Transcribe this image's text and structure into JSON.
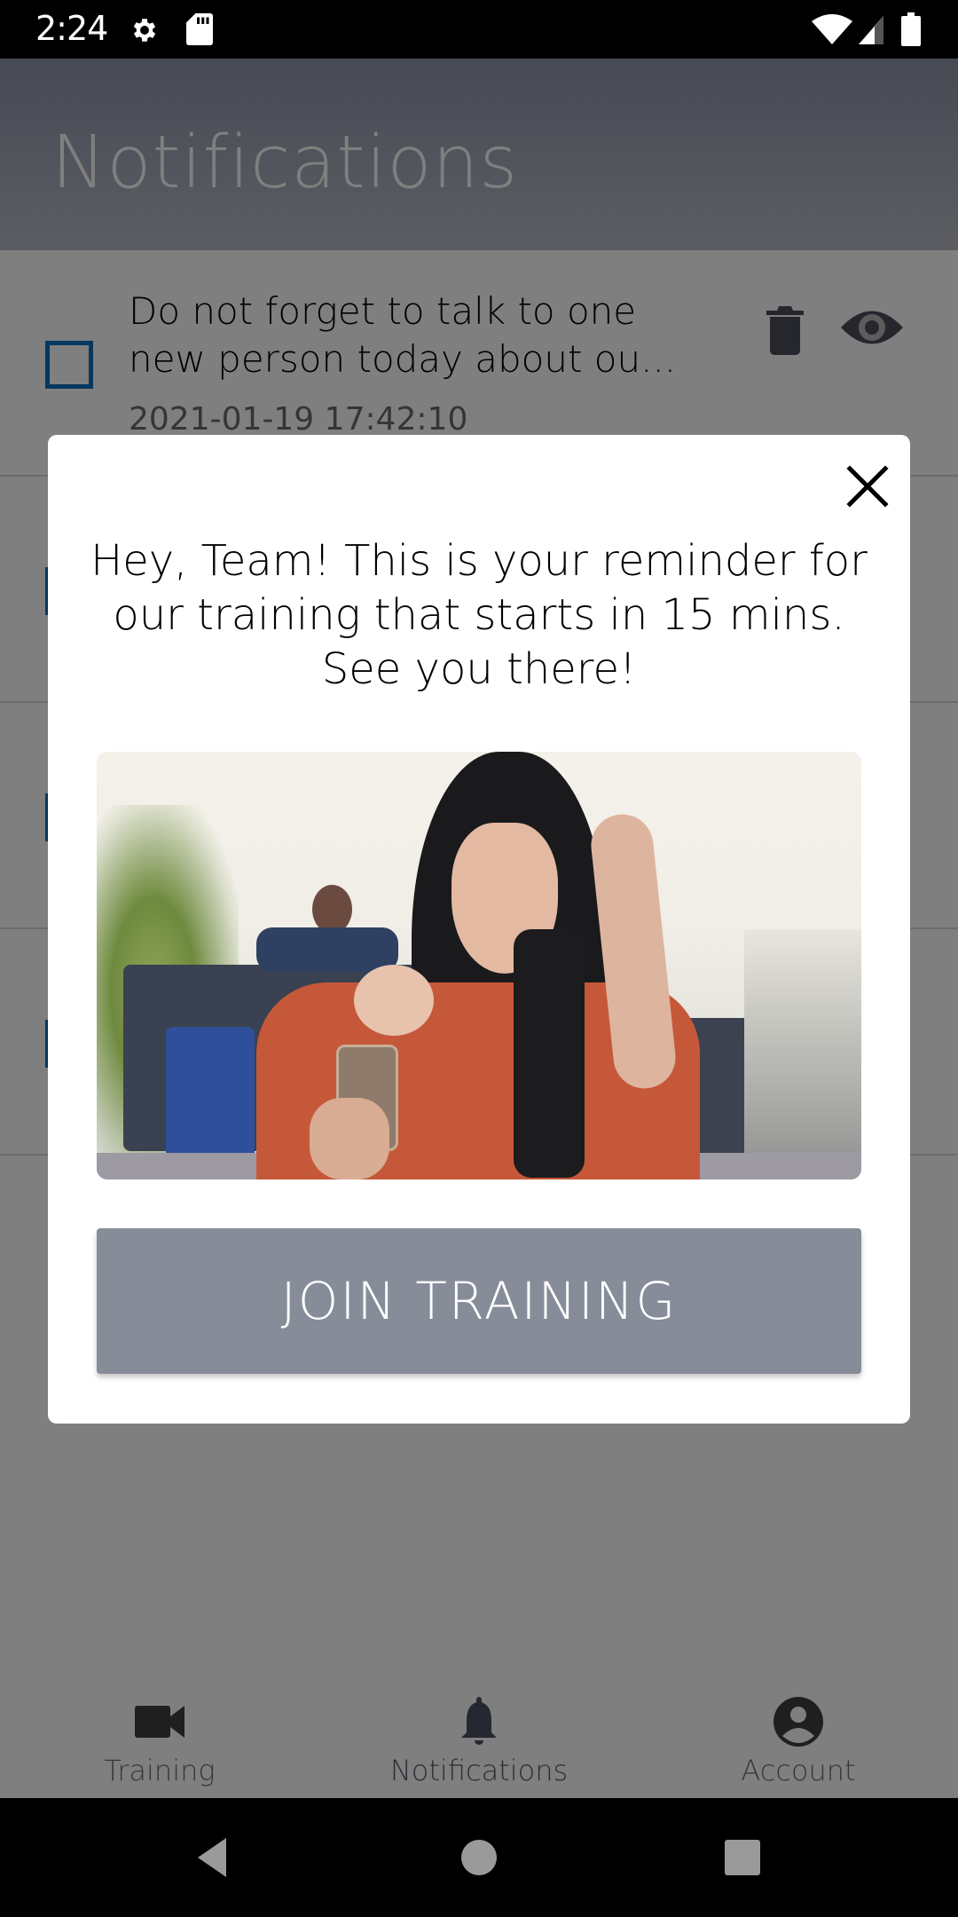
{
  "status_bar": {
    "time": "2:24",
    "icons": [
      "gear-icon",
      "sd-card-icon",
      "wifi-icon",
      "signal-icon",
      "battery-icon"
    ]
  },
  "header": {
    "title": "Notifications"
  },
  "notifications": [
    {
      "text": "Do not forget to talk to one new person today about ou...",
      "date": "2021-01-19 17:42:10",
      "checked": false
    },
    {
      "text": "",
      "date": "",
      "checked": false
    },
    {
      "text": "",
      "date": "",
      "checked": false
    },
    {
      "text": "",
      "date": "",
      "checked": false
    }
  ],
  "item_actions": {
    "delete_icon": "trash-icon",
    "view_icon": "eye-icon"
  },
  "dialog": {
    "message": "Hey, Team! This is your reminder for our training that starts in 15 mins. See you there!",
    "image_description": "Woman in orange top looking at a smartphone at an outdoor cafe",
    "button_label": "JOIN TRAINING",
    "close_icon": "close-icon"
  },
  "bottom_nav": {
    "items": [
      {
        "label": "Training",
        "icon": "video-camera-icon",
        "active": false
      },
      {
        "label": "Notifications",
        "icon": "bell-icon",
        "active": true
      },
      {
        "label": "Account",
        "icon": "account-circle-icon",
        "active": false
      }
    ]
  },
  "system_nav": {
    "back": "back-icon",
    "home": "home-icon",
    "recents": "recents-icon"
  },
  "colors": {
    "accent": "#0a6fbf",
    "button": "#878c99",
    "header_gradient_top": "#8d95a8",
    "icon_dark": "#4a4f5a"
  }
}
